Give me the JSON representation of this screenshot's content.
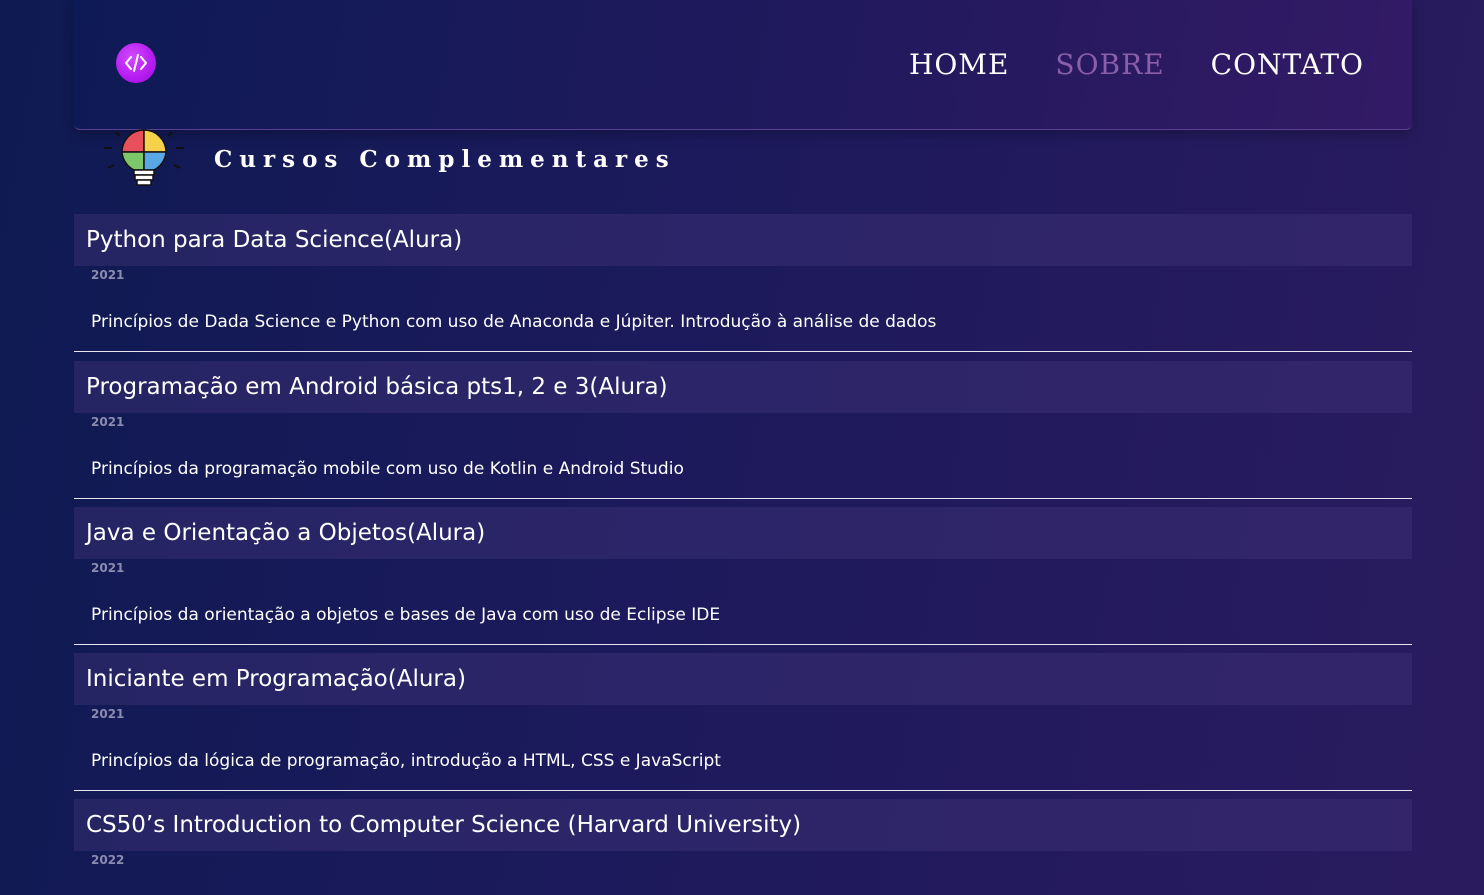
{
  "header": {
    "logo_icon": "code-icon",
    "nav": [
      {
        "label": "HOME",
        "active": false
      },
      {
        "label": "SOBRE",
        "active": true
      },
      {
        "label": "CONTATO",
        "active": false
      }
    ]
  },
  "section": {
    "icon": "lightbulb-puzzle-icon",
    "title": "Cursos Complementares"
  },
  "courses": [
    {
      "title": "Python para Data Science(Alura)",
      "year": "2021",
      "description": "Princípios de Dada Science e Python com uso de Anaconda e Júpiter. Introdução à análise de dados"
    },
    {
      "title": "Programação em Android básica pts1, 2 e 3(Alura)",
      "year": "2021",
      "description": "Princípios da programação mobile com uso de Kotlin e Android Studio"
    },
    {
      "title": "Java e Orientação a Objetos(Alura)",
      "year": "2021",
      "description": "Princípios da orientação a objetos e bases de Java com uso de Eclipse IDE"
    },
    {
      "title": "Iniciante em Programação(Alura)",
      "year": "2021",
      "description": "Princípios da lógica de programação, introdução a HTML, CSS e JavaScript"
    },
    {
      "title": "CS50’s Introduction to Computer Science (Harvard University)",
      "year": "2022",
      "description": ""
    }
  ],
  "colors": {
    "accent": "#b51bf0",
    "active_nav": "#8a5ea8"
  }
}
